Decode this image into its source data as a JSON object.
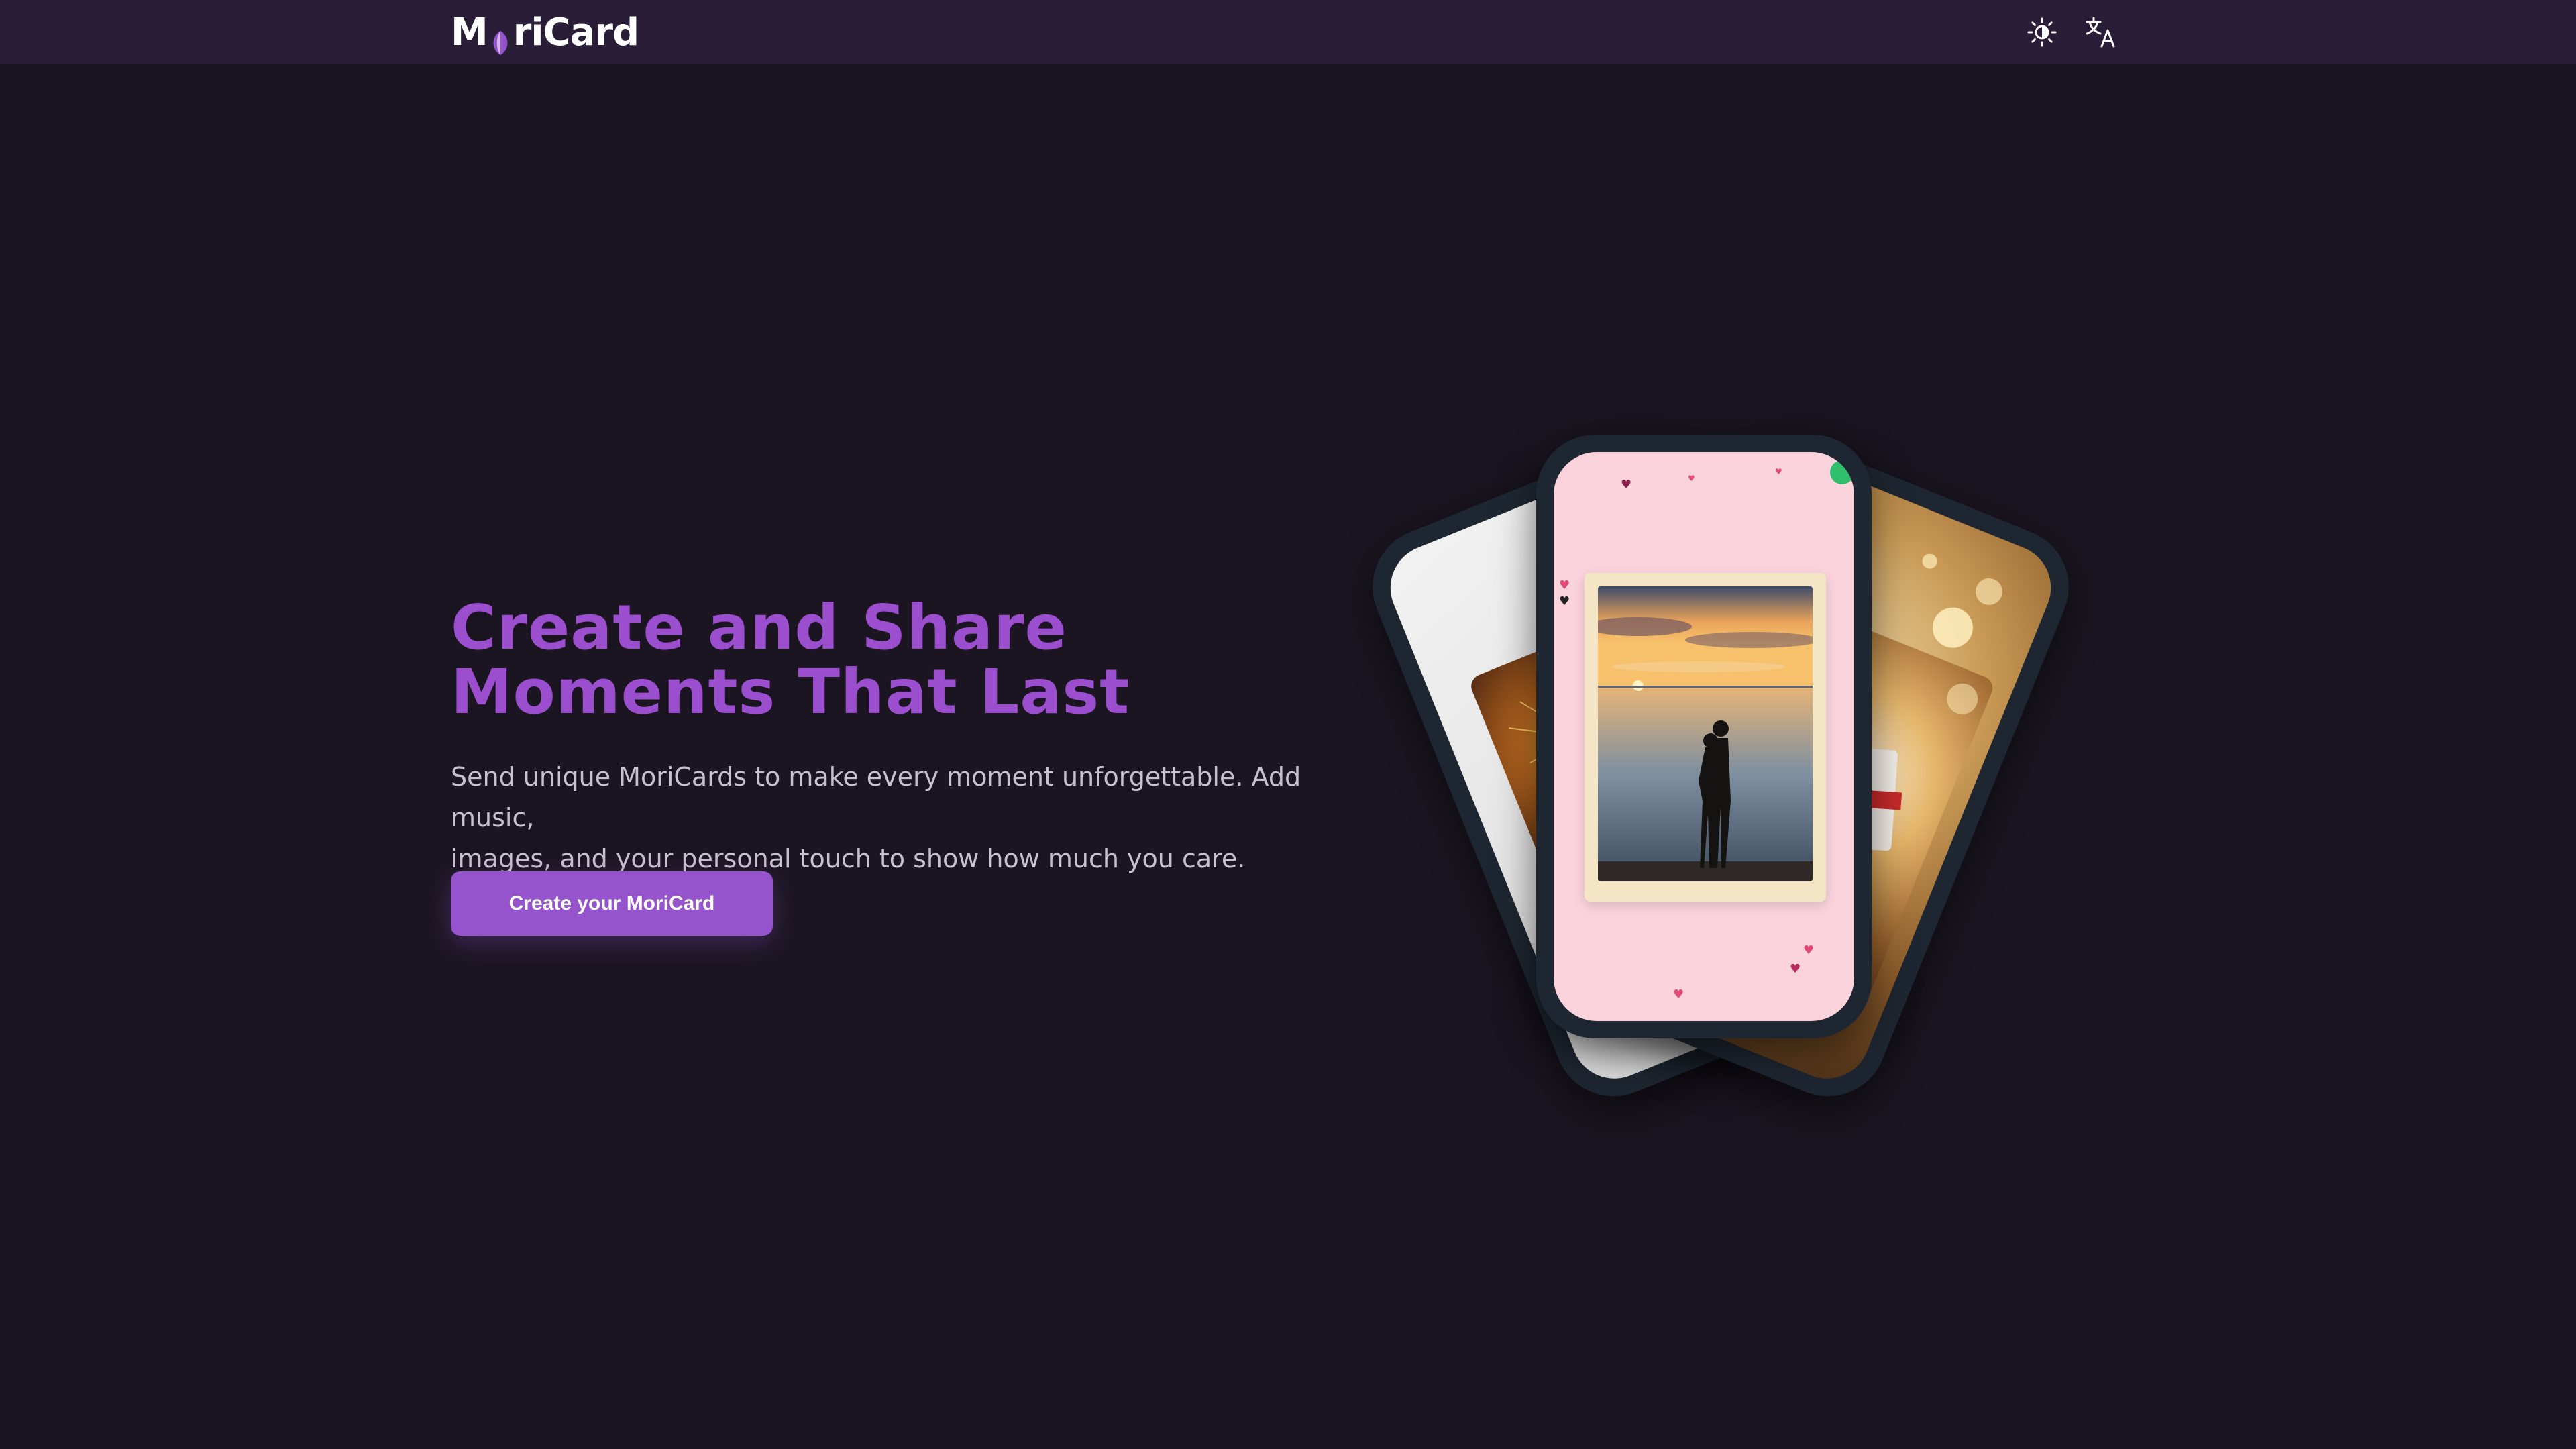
{
  "brand": {
    "logo_m": "M",
    "logo_rest": "riCard",
    "accent_color": "#9553cc",
    "header_color": "#2a1d38",
    "background_color": "#1a1520"
  },
  "header": {
    "theme_icon": "sun-moon-icon",
    "language_icon": "translate-icon"
  },
  "hero": {
    "title_line1": "Create and Share",
    "title_line2": "Moments That Last",
    "subtitle_line1": "Send unique MoriCards to make every moment unforgettable. Add music,",
    "subtitle_line2": "images, and your personal touch to show how much you care.",
    "cta_label": "Create your MoriCard",
    "title_color": "#9b4fcf"
  },
  "showcase": {
    "cards": [
      {
        "theme": "fireworks"
      },
      {
        "theme": "romantic-sunset"
      },
      {
        "theme": "gift"
      }
    ]
  }
}
